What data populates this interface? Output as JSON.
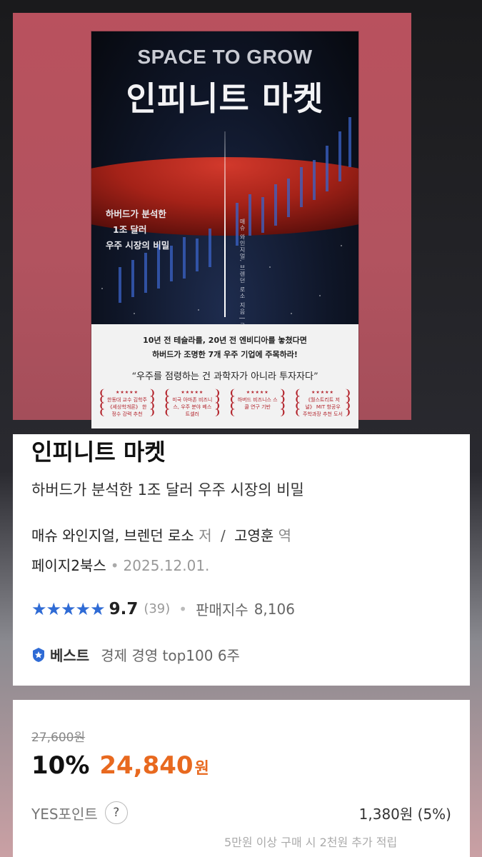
{
  "cover": {
    "title_en": "SPACE TO GROW",
    "title_ko": "인피니트 마켓",
    "tagline": [
      "하버드가 분석한",
      "1조 달러",
      "우주 시장의 비밀"
    ],
    "authors_vertical": "매슈 와인지얼, 브렌던 로소 지음 | 고영훈 옮김",
    "promo_line1": "10년 전 테슬라를, 20년 전 엔비디아를 놓쳤다면",
    "promo_line2": "하버드가 조명한 7개 우주 기업에 주목하라!",
    "quote": "“우주를 점령하는 건 과학자가 아니라 투자자다”",
    "awards": [
      {
        "stars": "★★★★★",
        "text": "한동대 교수 김학주 《세상학개론》 한정수 강력 추천"
      },
      {
        "stars": "★★★★★",
        "text": "미국 아마존 비즈니스, 우주 분야 베스트셀러"
      },
      {
        "stars": "★★★★★",
        "text": "하버드 비즈니스 스쿨 연구 기반"
      },
      {
        "stars": "★★★★★",
        "text": "《월스트리트 저널》 MIT 항공우주학과장 추천 도서"
      }
    ]
  },
  "book": {
    "title": "인피니트 마켓",
    "subtitle": "하버드가 분석한 1조 달러 우주 시장의 비밀",
    "authors": "매슈 와인지얼, 브렌던 로소",
    "author_role": "저",
    "translator": "고영훈",
    "translator_role": "역",
    "publisher": "페이지2북스",
    "date": "2025.12.01.",
    "rating_stars": "★★★★★",
    "rating": "9.7",
    "review_count": "(39)",
    "sales_label": "판매지수",
    "sales_index": "8,106",
    "best_label": "베스트",
    "best_text": "경제 경영 top100 6주"
  },
  "price": {
    "original": "27,600원",
    "discount": "10%",
    "sale": "24,840",
    "currency": "원",
    "point_label": "YES포인트",
    "point_help": "?",
    "point_value": "1,380원 (5%)",
    "note": "5만원 이상 구매 시 2천원 추가 적립"
  },
  "colors": {
    "accent_price": "#e8691f",
    "rating_blue": "#2f6bd5",
    "hero_bg": "#b9515e"
  }
}
